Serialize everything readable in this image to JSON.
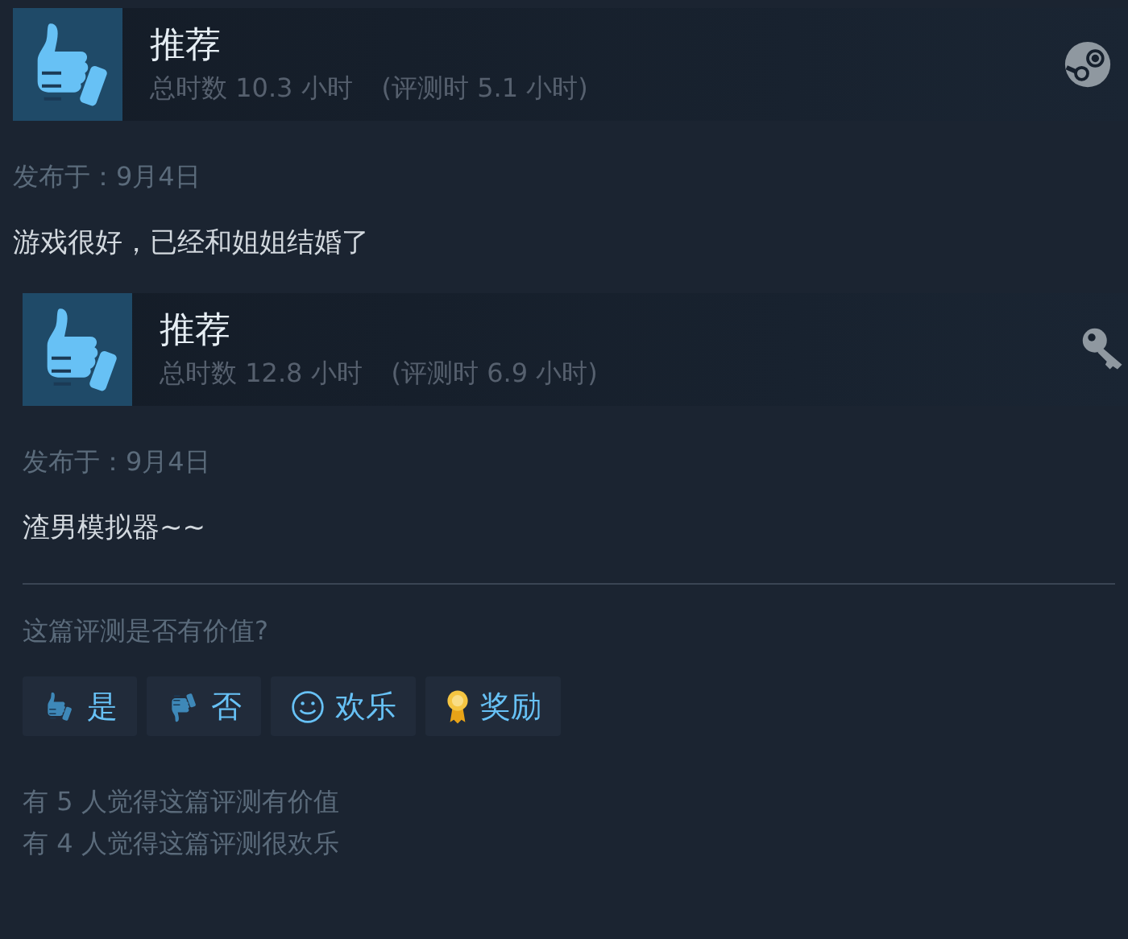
{
  "reviews": [
    {
      "verdict": "推荐",
      "recommended": true,
      "hours": "总时数 10.3 小时",
      "review_hours": "(评测时 5.1 小时)",
      "kind": "steam",
      "date": "发布于：9月4日",
      "text": "游戏很好，已经和姐姐结婚了"
    },
    {
      "verdict": "推荐",
      "recommended": true,
      "hours": "总时数 12.8 小时",
      "review_hours": "(评测时 6.9 小时)",
      "kind": "key",
      "date": "发布于：9月4日",
      "text": "渣男模拟器~~"
    }
  ],
  "helpful": {
    "question": "这篇评测是否有价值?",
    "buttons": [
      {
        "kind": "yes",
        "label": "是"
      },
      {
        "kind": "no",
        "label": "否"
      },
      {
        "kind": "funny",
        "label": "欢乐"
      },
      {
        "kind": "award",
        "label": "奖励"
      }
    ],
    "counts": [
      "有 5 人觉得这篇评测有价值",
      "有 4 人觉得这篇评测很欢乐"
    ]
  }
}
